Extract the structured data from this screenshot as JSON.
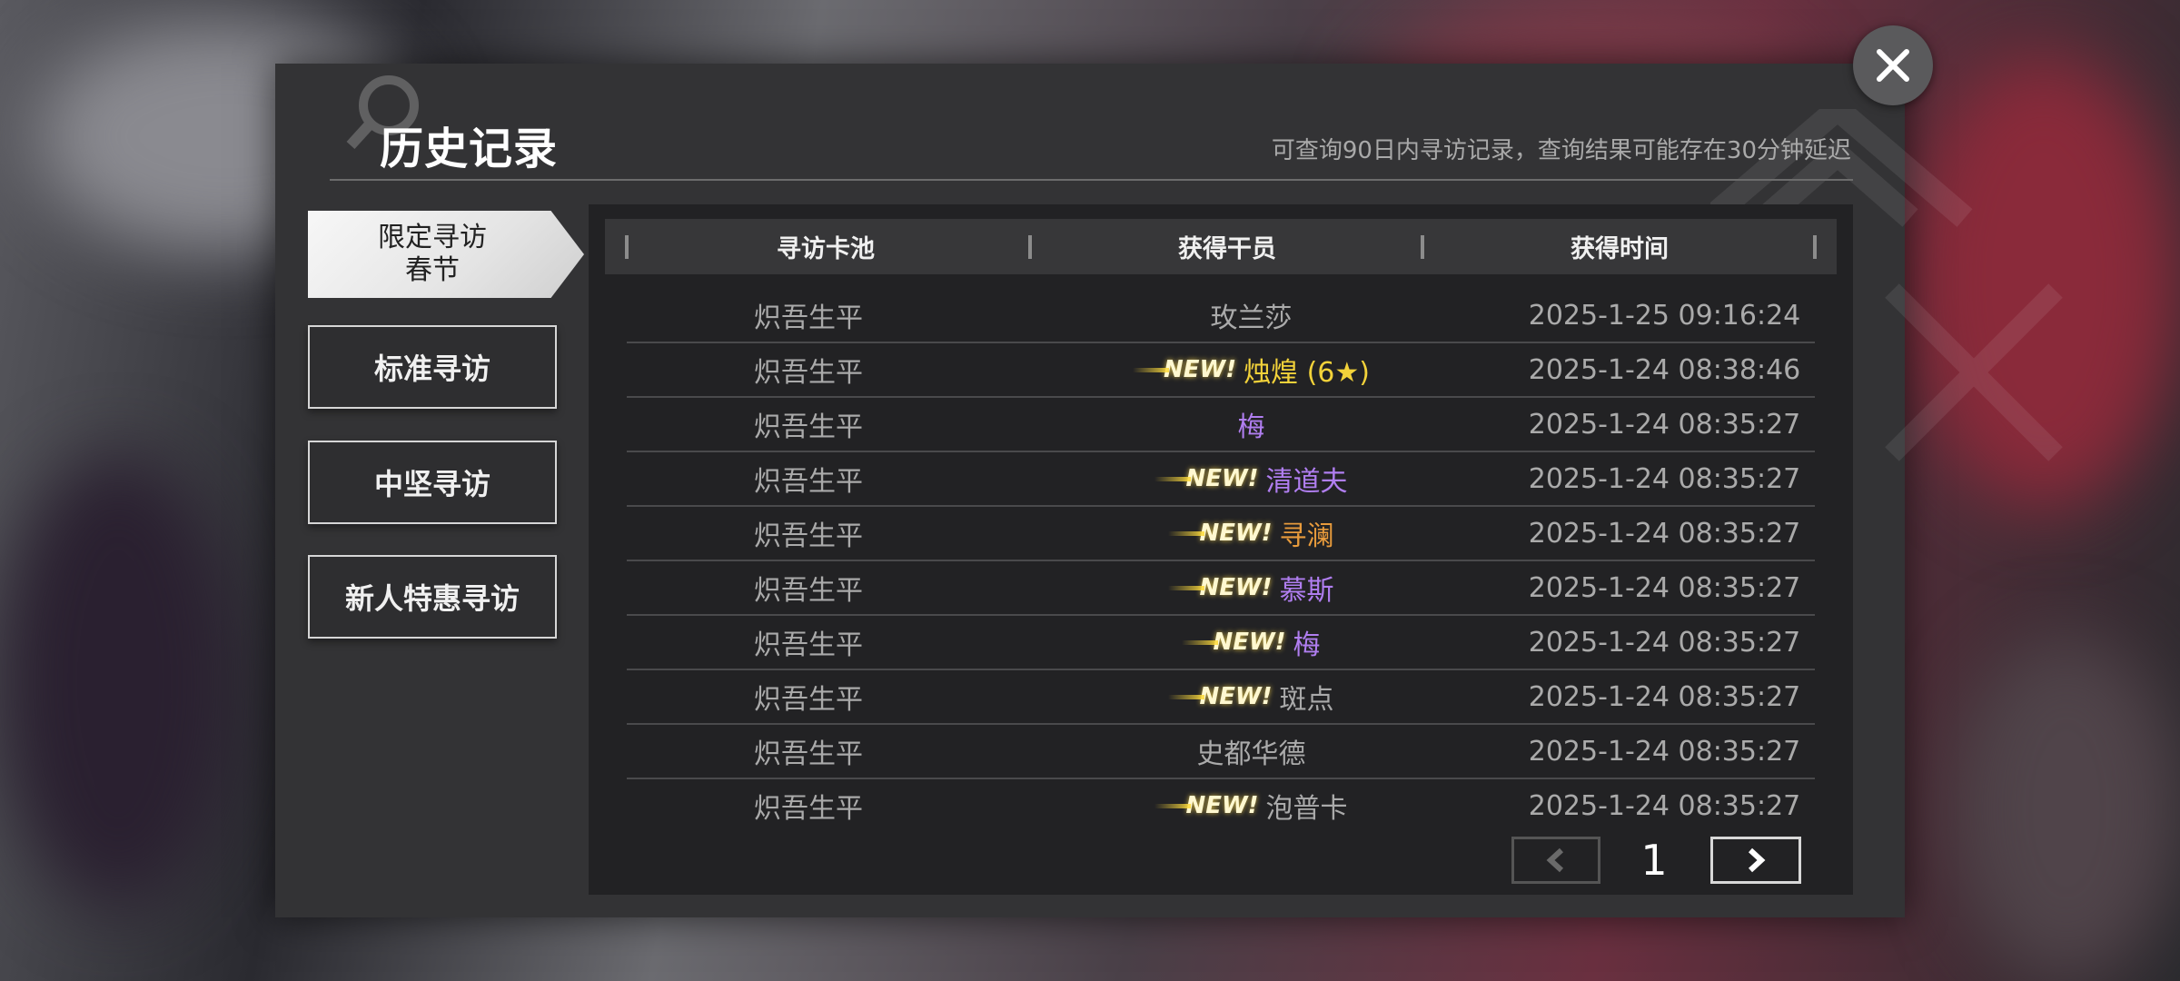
{
  "dialog": {
    "title": "历史记录",
    "subtitle": "可查询90日内寻访记录，查询结果可能存在30分钟延迟"
  },
  "sidebar": {
    "items": [
      {
        "label_line1": "限定寻访",
        "label_line2": "春节",
        "active": true
      },
      {
        "label": "标准寻访",
        "active": false
      },
      {
        "label": "中坚寻访",
        "active": false
      },
      {
        "label": "新人特惠寻访",
        "active": false
      }
    ]
  },
  "table": {
    "columns": [
      "寻访卡池",
      "获得干员",
      "获得时间"
    ],
    "new_badge": "NEW!",
    "rows": [
      {
        "pool": "炽吾生平",
        "operator": "玫兰莎",
        "new": false,
        "color": "#aaaaaa",
        "time": "2025-1-25 09:16:24"
      },
      {
        "pool": "炽吾生平",
        "operator": "烛煌 (6★)",
        "new": true,
        "color": "#f2d23a",
        "time": "2025-1-24 08:38:46"
      },
      {
        "pool": "炽吾生平",
        "operator": "梅",
        "new": false,
        "color": "#b07ef0",
        "time": "2025-1-24 08:35:27"
      },
      {
        "pool": "炽吾生平",
        "operator": "清道夫",
        "new": true,
        "color": "#b07ef0",
        "time": "2025-1-24 08:35:27"
      },
      {
        "pool": "炽吾生平",
        "operator": "寻澜",
        "new": true,
        "color": "#e89b3c",
        "time": "2025-1-24 08:35:27"
      },
      {
        "pool": "炽吾生平",
        "operator": "慕斯",
        "new": true,
        "color": "#b07ef0",
        "time": "2025-1-24 08:35:27"
      },
      {
        "pool": "炽吾生平",
        "operator": "梅",
        "new": true,
        "color": "#b07ef0",
        "time": "2025-1-24 08:35:27"
      },
      {
        "pool": "炽吾生平",
        "operator": "斑点",
        "new": true,
        "color": "#aaaaaa",
        "time": "2025-1-24 08:35:27"
      },
      {
        "pool": "炽吾生平",
        "operator": "史都华德",
        "new": false,
        "color": "#aaaaaa",
        "time": "2025-1-24 08:35:27"
      },
      {
        "pool": "炽吾生平",
        "operator": "泡普卡",
        "new": true,
        "color": "#aaaaaa",
        "time": "2025-1-24 08:35:27"
      }
    ]
  },
  "pagination": {
    "current_page": "1",
    "prev_icon": "chevron-left-icon",
    "next_icon": "chevron-right-icon"
  },
  "icons": {
    "close": "close-icon",
    "title_decoration": "search-icon"
  }
}
